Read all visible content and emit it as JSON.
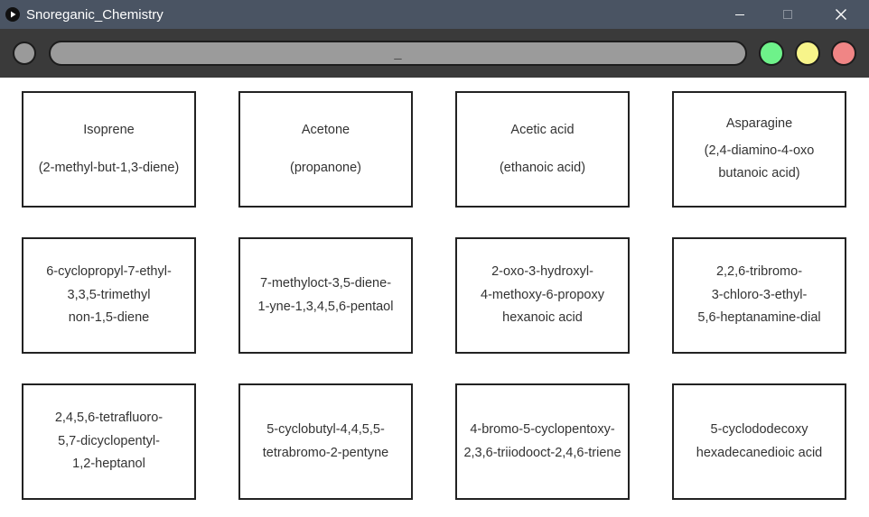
{
  "window": {
    "title": "Snoreganic_Chemistry"
  },
  "toolbar": {
    "input_value": "_"
  },
  "colors": {
    "titlebar": "#4a5463",
    "toolbar": "#3a3a3a",
    "green": "#6ef28a",
    "yellow": "#f7f48a",
    "red": "#f08585"
  },
  "cards": [
    {
      "common": "Isoprene",
      "systematic": [
        "(2-methyl-but-1,3-diene)"
      ]
    },
    {
      "common": "Acetone",
      "systematic": [
        "(propanone)"
      ]
    },
    {
      "common": "Acetic acid",
      "systematic": [
        "(ethanoic acid)"
      ]
    },
    {
      "common": "Asparagine",
      "systematic": [
        "(2,4-diamino-4-oxo",
        "butanoic acid)"
      ]
    },
    {
      "lines": [
        "6-cyclopropyl-7-ethyl-",
        "3,3,5-trimethyl",
        "non-1,5-diene"
      ]
    },
    {
      "lines": [
        "7-methyloct-3,5-diene-",
        "1-yne-1,3,4,5,6-pentaol"
      ]
    },
    {
      "lines": [
        "2-oxo-3-hydroxyl-",
        "4-methoxy-6-propoxy",
        "hexanoic acid"
      ]
    },
    {
      "lines": [
        "2,2,6-tribromo-",
        "3-chloro-3-ethyl-",
        "5,6-heptanamine-dial"
      ]
    },
    {
      "lines": [
        "2,4,5,6-tetrafluoro-",
        "5,7-dicyclopentyl-",
        "1,2-heptanol"
      ]
    },
    {
      "lines": [
        "5-cyclobutyl-4,4,5,5-",
        "tetrabromo-2-pentyne"
      ]
    },
    {
      "lines": [
        "4-bromo-5-cyclopentoxy-",
        "2,3,6-triiodooct-2,4,6-triene"
      ]
    },
    {
      "lines": [
        "5-cyclododecoxy",
        "hexadecanedioic acid"
      ]
    }
  ]
}
